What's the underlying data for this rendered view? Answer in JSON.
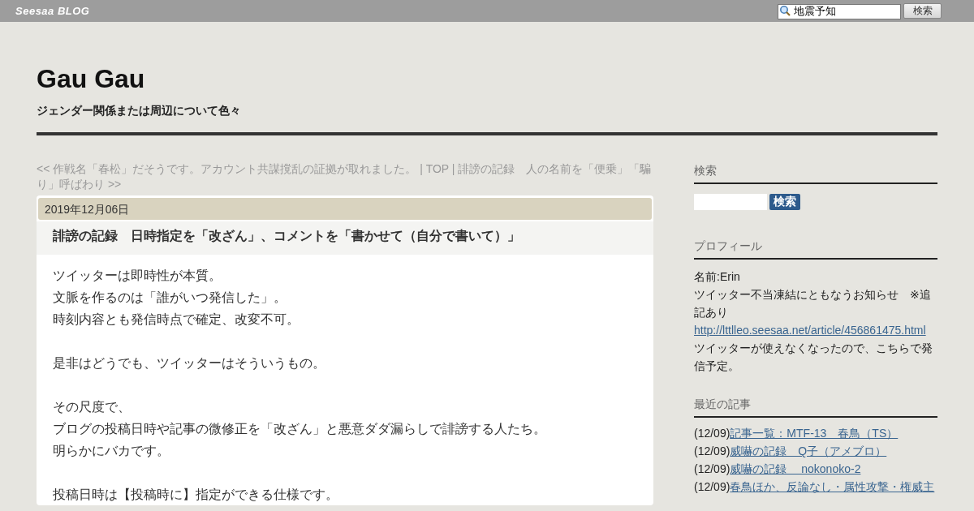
{
  "topbar": {
    "logo": "Seesaa BLOG",
    "search_value": "地震予知",
    "search_button": "検索"
  },
  "blog": {
    "title": "Gau Gau",
    "subtitle": "ジェンダー関係または周辺について色々"
  },
  "nav": "<< 作戦名「春松」だそうです。アカウント共謀撹乱の証拠が取れました。 | TOP | 誹謗の記録　人の名前を「便乗」「騙り」呼ばわり >>",
  "post": {
    "date": "2019年12月06日",
    "title": "誹謗の記録　日時指定を「改ざん」、コメントを「書かせて（自分で書いて）」",
    "paragraphs": [
      [
        "ツイッターは即時性が本質。",
        "文脈を作るのは「誰がいつ発信した」。",
        "時刻内容とも発信時点で確定、改変不可。"
      ],
      [
        "是非はどうでも、ツイッターはそういうもの。"
      ],
      [
        "その尺度で、",
        "ブログの投稿日時や記事の微修正を「改ざん」と悪意ダダ漏らしで誹謗する人たち。",
        "明らかにバカです。"
      ],
      [
        "投稿日時は【投稿時に】指定ができる仕様です。"
      ]
    ]
  },
  "sidebar": {
    "search": {
      "heading": "検索",
      "button": "検索"
    },
    "profile": {
      "heading": "プロフィール",
      "lines": [
        {
          "kind": "text",
          "text": "名前:Erin"
        },
        {
          "kind": "text",
          "text": "ツイッター不当凍結にともなうお知らせ　※追記あり"
        },
        {
          "kind": "link",
          "text": "http://lttlleo.seesaa.net/article/456861475.html"
        },
        {
          "kind": "text",
          "text": "ツイッターが使えなくなったので、こちらで発信予定。"
        }
      ]
    },
    "recent": {
      "heading": "最近の記事",
      "items": [
        {
          "date": "(12/09)",
          "title": "記事一覧：MTF-13　春鳥（TS）"
        },
        {
          "date": "(12/09)",
          "title": "威嚇の記録　Q子（アメブロ）"
        },
        {
          "date": "(12/09)",
          "title": "威嚇の記録　 nokonoko-2"
        },
        {
          "date": "(12/09)",
          "title": "春鳥ほか、反論なし・属性攻撃・権威主"
        }
      ]
    }
  }
}
